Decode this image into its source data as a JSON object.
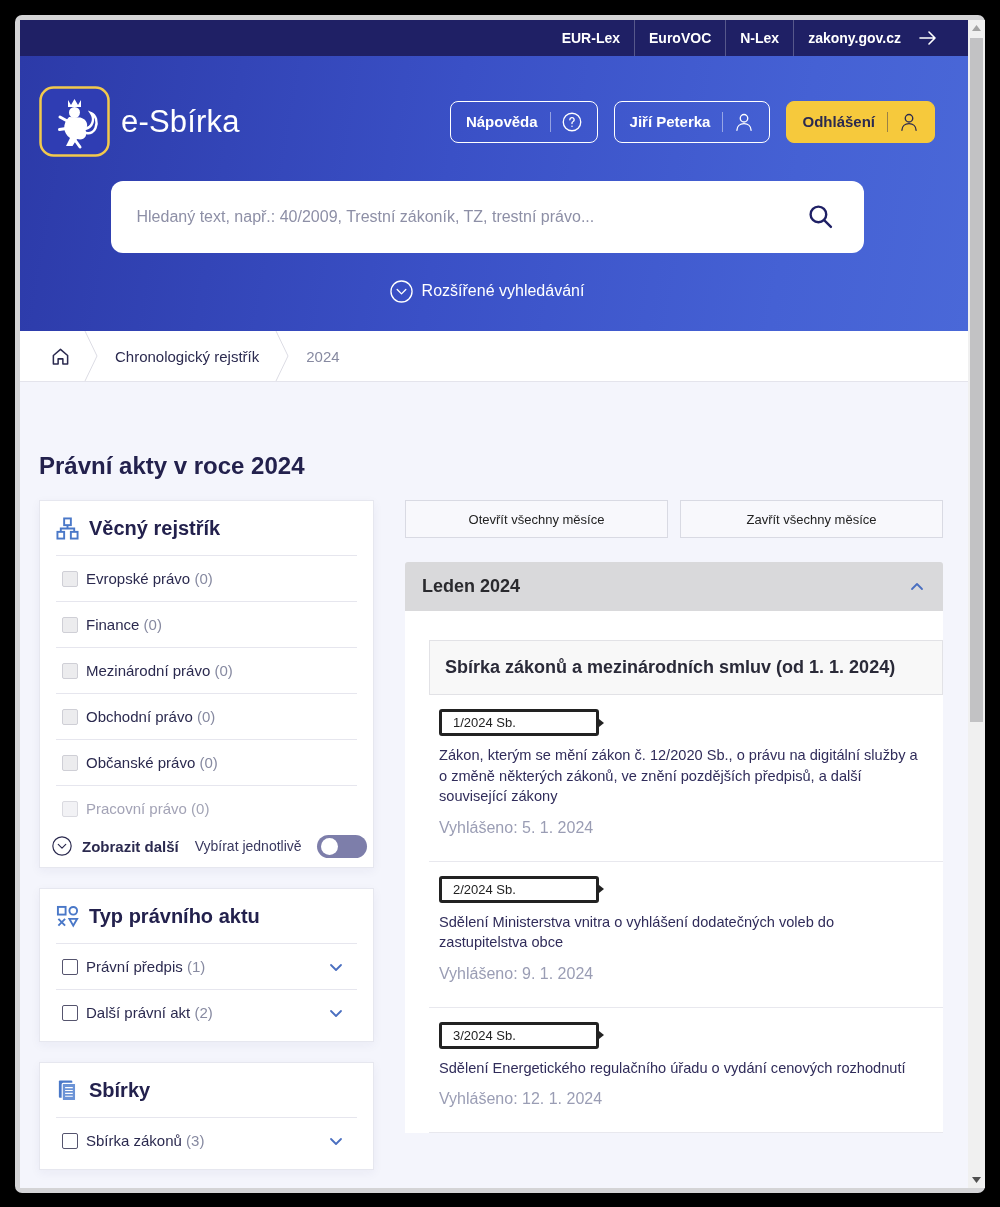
{
  "top_links": [
    "EUR-Lex",
    "EuroVOC",
    "N-Lex",
    "zakony.gov.cz"
  ],
  "header": {
    "site_name": "e-Sbírka",
    "buttons": [
      {
        "label": "Nápověda",
        "kind": "help"
      },
      {
        "label": "Jiří Peterka",
        "kind": "account"
      },
      {
        "label": "Odhlášení",
        "kind": "logout"
      }
    ]
  },
  "search": {
    "placeholder": "Hledaný text, např.: 40/2009, Trestní zákoník, TZ, trestní právo..."
  },
  "advanced_search": "Rozšířené vyhledávání",
  "breadcrumb": [
    {
      "label": "Chronologický rejstřík",
      "current": false
    },
    {
      "label": "2024",
      "current": true
    }
  ],
  "page_title": "Právní akty v roce 2024",
  "filters": [
    {
      "title": "Věcný rejstřík",
      "kind": "subjects",
      "items": [
        {
          "label": "Evropské právo",
          "count": "(0)",
          "checked": false,
          "disabled": true,
          "faded": false
        },
        {
          "label": "Finance",
          "count": "(0)",
          "checked": false,
          "disabled": true,
          "faded": false
        },
        {
          "label": "Mezinárodní právo",
          "count": "(0)",
          "checked": false,
          "disabled": true,
          "faded": false
        },
        {
          "label": "Obchodní právo",
          "count": "(0)",
          "checked": false,
          "disabled": true,
          "faded": false
        },
        {
          "label": "Občanské právo",
          "count": "(0)",
          "checked": false,
          "disabled": true,
          "faded": false
        },
        {
          "label": "Pracovní právo",
          "count": "(0)",
          "checked": false,
          "disabled": true,
          "faded": true
        }
      ],
      "show_more": "Zobrazit další",
      "toggle": {
        "label": "Vybírat jednotlivě",
        "on": false
      }
    },
    {
      "title": "Typ právního aktu",
      "kind": "act_types",
      "items": [
        {
          "label": "Právní předpis",
          "count": "(1)",
          "checked": false,
          "disabled": false,
          "expanded": false
        },
        {
          "label": "Další právní akt",
          "count": "(2)",
          "checked": false,
          "disabled": false,
          "expanded": false
        }
      ]
    },
    {
      "title": "Sbírky",
      "kind": "collections",
      "items": [
        {
          "label": "Sbírka zákonů",
          "count": "(3)",
          "checked": false,
          "disabled": false,
          "expanded": false
        }
      ]
    }
  ],
  "month_buttons": [
    "Otevřít všechny měsíce",
    "Zavřít všechny měsíce"
  ],
  "months": [
    {
      "title": "Leden 2024",
      "expanded": true,
      "collections": [
        {
          "title": "Sbírka zákonů a mezinárodních smluv (od 1. 1. 2024)",
          "acts": [
            {
              "number": "1/2024 Sb.",
              "title": "Zákon, kterým se mění zákon č. 12/2020 Sb., o právu na digitální služby a o změně některých zákonů, ve znění pozdějších předpisů, a další související zákony",
              "published": "Vyhlášeno: 5. 1. 2024"
            },
            {
              "number": "2/2024 Sb.",
              "title": "Sdělení Ministerstva vnitra o vyhlášení dodatečných voleb do zastupitelstva obce",
              "published": "Vyhlášeno: 9. 1. 2024"
            },
            {
              "number": "3/2024 Sb.",
              "title": "Sdělení Energetického regulačního úřadu o vydání cenových rozhodnutí",
              "published": "Vyhlášeno: 12. 1. 2024"
            }
          ]
        }
      ]
    }
  ]
}
